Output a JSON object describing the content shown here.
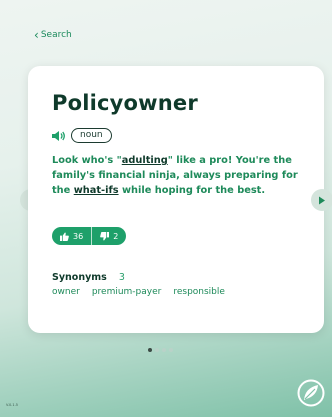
{
  "nav": {
    "back_label": "Search"
  },
  "entry": {
    "word": "Policyowner",
    "part_of_speech": "noun",
    "definition_parts": [
      {
        "text": "Look who's \"",
        "link": false
      },
      {
        "text": "adulting",
        "link": true
      },
      {
        "text": "\" like a pro! You're the family's financial ninja, always preparing for the ",
        "link": false
      },
      {
        "text": "what-ifs",
        "link": true
      },
      {
        "text": " while hoping for the best.",
        "link": false
      }
    ],
    "upvotes": "36",
    "downvotes": "2",
    "synonyms_label": "Synonyms",
    "synonyms_count": "3",
    "synonyms": [
      "owner",
      "premium-payer",
      "responsible"
    ]
  },
  "pagination": {
    "total": 4,
    "active": 0
  },
  "footer": {
    "version": "V.0.1.5"
  },
  "colors": {
    "accent": "#1ea06a",
    "text_dark": "#0f3a2b",
    "text_green": "#1e8a5a"
  },
  "icons": {
    "back": "chevron-left-icon",
    "audio": "speaker-icon",
    "upvote": "thumbs-up-icon",
    "downvote": "thumbs-down-icon",
    "prev": "triangle-left-icon",
    "next": "triangle-right-icon",
    "logo": "leaf-logo-icon"
  }
}
